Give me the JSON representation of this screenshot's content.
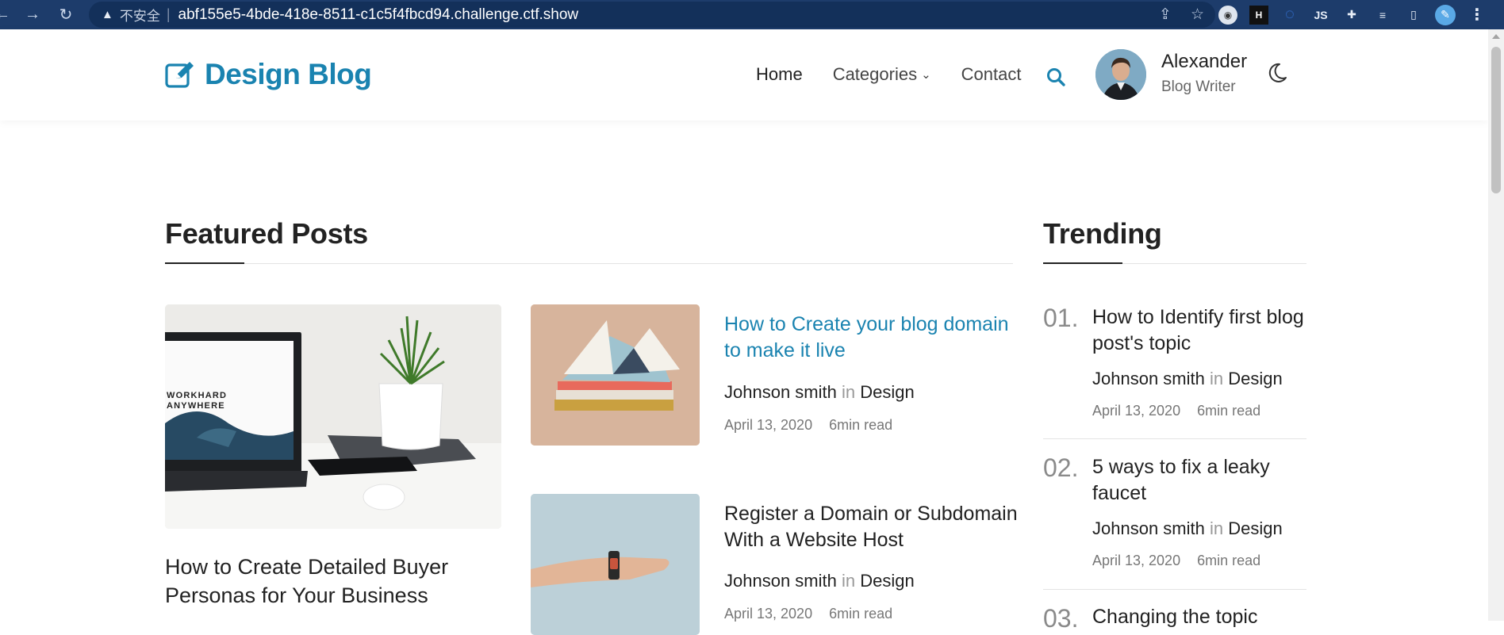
{
  "browser": {
    "security_label": "不安全",
    "url": "abf155e5-4bde-418e-8511-c1c5f4fbcd94.challenge.ctf.show",
    "extensions": [
      "ext-a",
      "H",
      "ext-c",
      "JS",
      "puzzle-icon",
      "media-icon",
      "sidebar-icon",
      "profile-icon",
      "menu-icon"
    ]
  },
  "header": {
    "logo_text": "Design Blog",
    "nav": {
      "home": "Home",
      "categories": "Categories",
      "contact": "Contact"
    },
    "author": {
      "name": "Alexander",
      "role": "Blog Writer"
    }
  },
  "featured": {
    "heading": "Featured Posts",
    "main_post": {
      "title": "How to Create Detailed Buyer Personas for Your Business",
      "image_text": "WORKHARD\nANYWHERE"
    },
    "posts": [
      {
        "title": "How to Create your blog domain to make it live",
        "author": "Johnson smith",
        "in": "in",
        "category": "Design",
        "date": "April 13, 2020",
        "read": "6min read",
        "highlighted": true
      },
      {
        "title": "Register a Domain or Subdomain With a Website Host",
        "author": "Johnson smith",
        "in": "in",
        "category": "Design",
        "date": "April 13, 2020",
        "read": "6min read",
        "highlighted": false
      }
    ]
  },
  "trending": {
    "heading": "Trending",
    "items": [
      {
        "num": "01.",
        "title": "How to Identify first blog post's topic",
        "author": "Johnson smith",
        "in": "in",
        "category": "Design",
        "date": "April 13, 2020",
        "read": "6min read"
      },
      {
        "num": "02.",
        "title": "5 ways to fix a leaky faucet",
        "author": "Johnson smith",
        "in": "in",
        "category": "Design",
        "date": "April 13, 2020",
        "read": "6min read"
      },
      {
        "num": "03.",
        "title": "Changing the topic"
      }
    ]
  },
  "colors": {
    "accent": "#1a83b0",
    "browser_bar": "#1d3c6b"
  }
}
